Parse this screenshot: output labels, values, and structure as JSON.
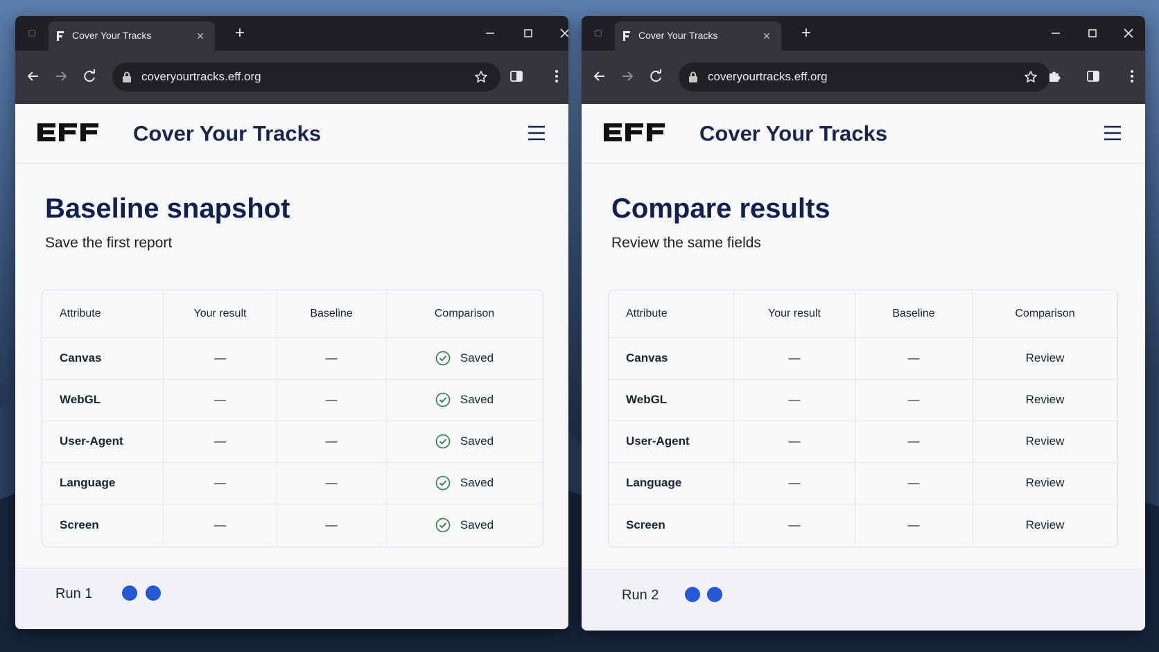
{
  "colors": {
    "accent": "#2557d6",
    "heading": "#12204a",
    "check": "#2f7a3d",
    "browser_dark": "#1f2023",
    "browser_toolbar": "#35363a"
  },
  "windows": [
    {
      "tab": {
        "title": "Cover Your Tracks"
      },
      "address": {
        "url": "coveryourtracks.eff.org"
      },
      "site": {
        "logo": "EFF",
        "title": "Cover Your Tracks"
      },
      "page": {
        "heading": "Baseline snapshot",
        "subheading": "Save the first report"
      },
      "table": {
        "headers": [
          "Attribute",
          "Your result",
          "Baseline",
          "Comparison"
        ],
        "rows": [
          {
            "attribute": "Canvas",
            "result": "—",
            "baseline": "—",
            "comparison": "Saved"
          },
          {
            "attribute": "WebGL",
            "result": "—",
            "baseline": "—",
            "comparison": "Saved"
          },
          {
            "attribute": "User-Agent",
            "result": "—",
            "baseline": "—",
            "comparison": "Saved"
          },
          {
            "attribute": "Language",
            "result": "—",
            "baseline": "—",
            "comparison": "Saved"
          },
          {
            "attribute": "Screen",
            "result": "—",
            "baseline": "—",
            "comparison": "Saved"
          }
        ]
      },
      "footer": {
        "run_label": "Run 1"
      }
    },
    {
      "tab": {
        "title": "Cover Your Tracks"
      },
      "address": {
        "url": "coveryourtracks.eff.org"
      },
      "site": {
        "logo": "EFF",
        "title": "Cover Your Tracks"
      },
      "page": {
        "heading": "Compare results",
        "subheading": "Review the same fields"
      },
      "table": {
        "headers": [
          "Attribute",
          "Your result",
          "Baseline",
          "Comparison"
        ],
        "rows": [
          {
            "attribute": "Canvas",
            "result": "—",
            "baseline": "—",
            "comparison": "Review"
          },
          {
            "attribute": "WebGL",
            "result": "—",
            "baseline": "—",
            "comparison": "Review"
          },
          {
            "attribute": "User-Agent",
            "result": "—",
            "baseline": "—",
            "comparison": "Review"
          },
          {
            "attribute": "Language",
            "result": "—",
            "baseline": "—",
            "comparison": "Review"
          },
          {
            "attribute": "Screen",
            "result": "—",
            "baseline": "—",
            "comparison": "Review"
          }
        ]
      },
      "footer": {
        "run_label": "Run 2"
      }
    }
  ]
}
